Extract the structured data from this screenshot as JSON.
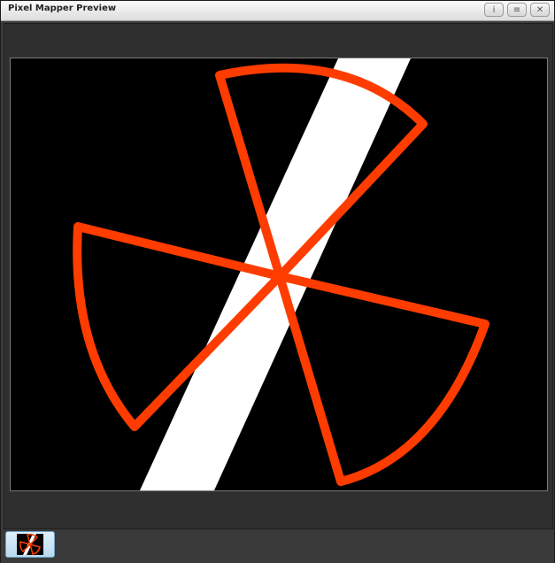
{
  "window": {
    "title": "Pixel Mapper Preview",
    "buttons": [
      {
        "name": "info",
        "glyph": "i"
      },
      {
        "name": "menu",
        "glyph": "≡"
      },
      {
        "name": "close",
        "glyph": "✕"
      }
    ]
  },
  "preview": {
    "background_color": "#000000",
    "beam_color": "#ffffff",
    "shape_color": "#ff3c00"
  },
  "thumbnails": [
    {
      "name": "pixel-map-preset-thumbnail",
      "selected": true
    }
  ]
}
